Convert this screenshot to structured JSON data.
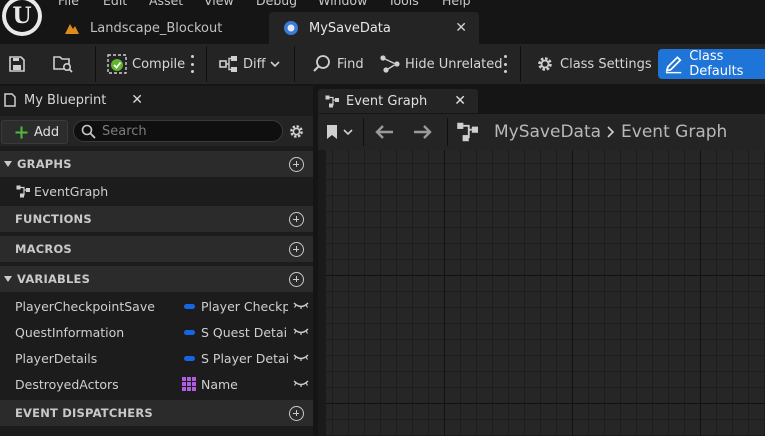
{
  "menu": [
    "File",
    "Edit",
    "Asset",
    "View",
    "Debug",
    "Window",
    "Tools",
    "Help"
  ],
  "doc_tabs": [
    {
      "label": "Landscape_Blockout",
      "icon": "landscape-icon"
    },
    {
      "label": "MySaveData",
      "icon": "blueprint-icon",
      "active": true
    }
  ],
  "toolbar": {
    "compile": "Compile",
    "diff": "Diff",
    "find": "Find",
    "hide_unrelated": "Hide Unrelated",
    "class_settings": "Class Settings",
    "class_defaults": "Class Defaults"
  },
  "my_blueprint": {
    "tab_label": "My Blueprint",
    "add_label": "Add",
    "search_placeholder": "Search",
    "sections": {
      "graphs": "GRAPHS",
      "functions": "FUNCTIONS",
      "macros": "MACROS",
      "variables": "VARIABLES",
      "event_dispatchers": "EVENT DISPATCHERS"
    },
    "graphs": [
      "EventGraph"
    ],
    "variables": [
      {
        "name": "PlayerCheckpointSave",
        "type": "Player Checkpoint Save",
        "type_color": "#1466e6"
      },
      {
        "name": "QuestInformation",
        "type": "S Quest Details",
        "type_color": "#1466e6"
      },
      {
        "name": "PlayerDetails",
        "type": "S Player Details",
        "type_color": "#1466e6"
      },
      {
        "name": "DestroyedActors",
        "type": "Name",
        "type_color": "#b05ee0"
      }
    ]
  },
  "graph": {
    "tab_label": "Event Graph",
    "breadcrumb": [
      "MySaveData",
      "Event Graph"
    ]
  },
  "colors": {
    "accent": "#1f74d8",
    "struct_pin": "#1466e6",
    "name_pin": "#b05ee0"
  }
}
